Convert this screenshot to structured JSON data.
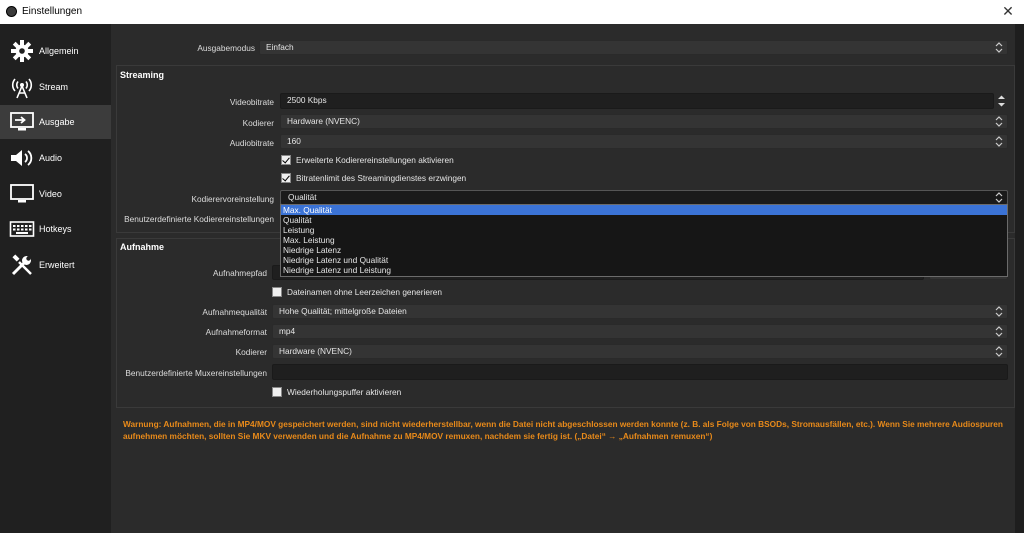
{
  "window": {
    "title": "Einstellungen",
    "close_glyph": "✕"
  },
  "sidebar": {
    "items": [
      {
        "label": "Allgemein",
        "icon": "gear-icon"
      },
      {
        "label": "Stream",
        "icon": "broadcast-tower-icon"
      },
      {
        "label": "Ausgabe",
        "icon": "output-monitor-icon"
      },
      {
        "label": "Audio",
        "icon": "speaker-icon"
      },
      {
        "label": "Video",
        "icon": "monitor-icon"
      },
      {
        "label": "Hotkeys",
        "icon": "keyboard-icon"
      },
      {
        "label": "Erweitert",
        "icon": "tools-icon"
      }
    ],
    "active_index": 2
  },
  "output_mode": {
    "label": "Ausgabemodus",
    "value": "Einfach"
  },
  "streaming": {
    "title": "Streaming",
    "video_bitrate": {
      "label": "Videobitrate",
      "value": "2500 Kbps"
    },
    "encoder": {
      "label": "Kodierer",
      "value": "Hardware (NVENC)"
    },
    "audio_bitrate": {
      "label": "Audiobitrate",
      "value": "160"
    },
    "advanced_encoder_checkbox": {
      "label": "Erweiterte Kodierereinstellungen aktivieren",
      "checked": true
    },
    "enforce_bitrate_checkbox": {
      "label": "Bitratenlimit des Streamingdienstes erzwingen",
      "checked": true
    },
    "encoder_preset": {
      "label": "Kodierervoreinstellung",
      "value": "Qualität",
      "options": [
        "Max. Qualität",
        "Qualität",
        "Leistung",
        "Max. Leistung",
        "Niedrige Latenz",
        "Niedrige Latenz und Qualität",
        "Niedrige Latenz und Leistung"
      ],
      "highlighted_index": 0
    },
    "custom_encoder_settings": {
      "label": "Benutzerdefinierte Kodierereinstellungen"
    }
  },
  "recording": {
    "title": "Aufnahme",
    "path": {
      "label": "Aufnahmepfad"
    },
    "no_space_checkbox": {
      "label": "Dateinamen ohne Leerzeichen generieren",
      "checked": false
    },
    "quality": {
      "label": "Aufnahmequalität",
      "value": "Hohe Qualität; mittelgroße Dateien"
    },
    "format": {
      "label": "Aufnahmeformat",
      "value": "mp4"
    },
    "encoder": {
      "label": "Kodierer",
      "value": "Hardware (NVENC)"
    },
    "custom_muxer": {
      "label": "Benutzerdefinierte Muxereinstellungen",
      "value": ""
    },
    "replay_buffer_checkbox": {
      "label": "Wiederholungspuffer aktivieren",
      "checked": false
    }
  },
  "warning": {
    "text": "Warnung: Aufnahmen, die in MP4/MOV gespeichert werden, sind nicht wiederherstellbar, wenn die Datei nicht abgeschlossen werden konnte (z. B. als Folge von BSODs, Stromausfällen, etc.). Wenn Sie mehrere Audiospuren aufnehmen möchten, sollten Sie MKV verwenden und die Aufnahme zu MP4/MOV remuxen, nachdem sie fertig ist. („Datei“ → „Aufnahmen remuxen“)",
    "color": "#e88a1a"
  },
  "colors": {
    "accent": "#3b73d6",
    "background": "#2b2b2b",
    "sidebar": "#202020"
  }
}
